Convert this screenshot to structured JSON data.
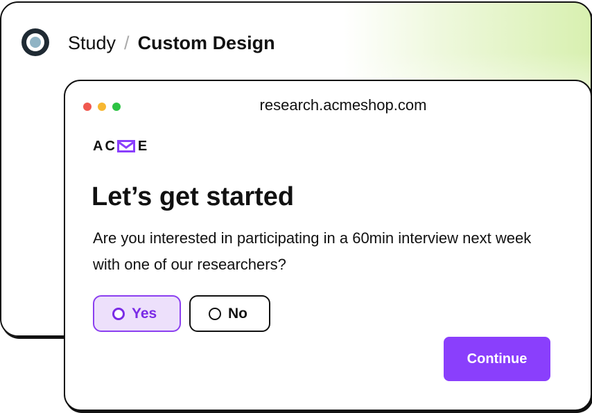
{
  "app": {
    "breadcrumb": {
      "parent": "Study",
      "separator": "/",
      "current": "Custom Design"
    }
  },
  "browser": {
    "url": "research.acmeshop.com"
  },
  "survey": {
    "brand_left": "AC",
    "brand_right": "E",
    "brand_icon": "envelope-m-icon",
    "heading": "Let’s get started",
    "question": "Are you interested in participating in a 60min interview next week with one of our researchers?",
    "options": [
      {
        "label": "Yes",
        "selected": true
      },
      {
        "label": "No",
        "selected": false
      }
    ],
    "continue_label": "Continue"
  },
  "colors": {
    "accent": "#8a3ffc",
    "accent_light": "#ede0fb",
    "gradient": "#d8f0b0"
  }
}
